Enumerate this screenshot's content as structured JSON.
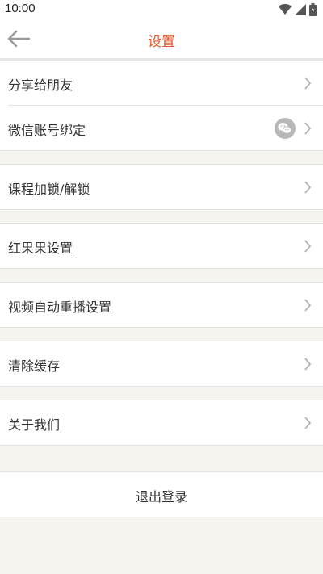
{
  "status_bar": {
    "time": "10:00"
  },
  "header": {
    "title": "设置",
    "back_icon": "arrow-left-icon"
  },
  "menu": {
    "share": "分享给朋友",
    "wechat_bind": "微信账号绑定",
    "course_lock": "课程加锁/解锁",
    "redfruit": "红果果设置",
    "video_replay": "视频自动重播设置",
    "clear_cache": "清除缓存",
    "about": "关于我们"
  },
  "logout": {
    "label": "退出登录"
  },
  "colors": {
    "accent": "#e8582a",
    "background": "#f5f4ee"
  }
}
